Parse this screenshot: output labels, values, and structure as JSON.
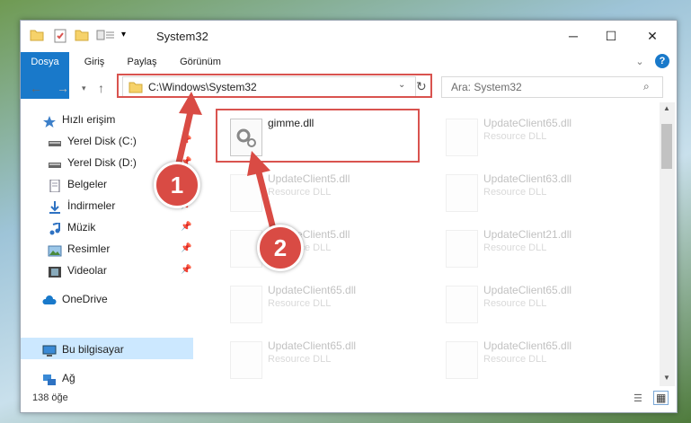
{
  "window": {
    "title": "System32",
    "controls": {
      "minimize": "─",
      "maximize": "☐",
      "close": "✕"
    }
  },
  "ribbon": {
    "tabs": [
      "Dosya",
      "Giriş",
      "Paylaş",
      "Görünüm"
    ],
    "expand": "⌄",
    "help": "?"
  },
  "address": {
    "path": "C:\\Windows\\System32",
    "search_placeholder": "Ara: System32"
  },
  "sidebar": {
    "items": [
      {
        "label": "Hızlı erişim",
        "icon": "star-icon"
      },
      {
        "label": "Yerel Disk (C:)",
        "icon": "drive-icon",
        "pinned": true
      },
      {
        "label": "Yerel Disk (D:)",
        "icon": "drive-icon",
        "pinned": true
      },
      {
        "label": "Belgeler",
        "icon": "documents-icon",
        "pinned": true
      },
      {
        "label": "İndirmeler",
        "icon": "download-icon",
        "pinned": true
      },
      {
        "label": "Müzik",
        "icon": "music-icon",
        "pinned": true
      },
      {
        "label": "Resimler",
        "icon": "pictures-icon",
        "pinned": true
      },
      {
        "label": "Videolar",
        "icon": "video-icon",
        "pinned": true
      },
      {
        "label": "OneDrive",
        "icon": "cloud-icon"
      },
      {
        "label": "Bu bilgisayar",
        "icon": "computer-icon",
        "selected": true
      },
      {
        "label": "Ağ",
        "icon": "network-icon"
      }
    ]
  },
  "files": [
    {
      "name": "gimme.dll",
      "desc": "",
      "highlighted": true
    },
    {
      "name": "UpdateClient65.dll",
      "desc": "Resource DLL"
    },
    {
      "name": "UpdateClient5.dll",
      "desc": "Resource DLL"
    },
    {
      "name": "UpdateClient63.dll",
      "desc": "Resource DLL"
    },
    {
      "name": "UpdateClient5.dll",
      "desc": "Resource DLL"
    },
    {
      "name": "UpdateClient21.dll",
      "desc": "Resource DLL"
    },
    {
      "name": "UpdateClient65.dll",
      "desc": "Resource DLL"
    },
    {
      "name": "UpdateClient65.dll",
      "desc": "Resource DLL"
    },
    {
      "name": "UpdateClient65.dll",
      "desc": "Resource DLL"
    },
    {
      "name": "UpdateClient65.dll",
      "desc": "Resource DLL"
    }
  ],
  "status": {
    "item_count": "138 öğe"
  },
  "annotations": {
    "step1": "1",
    "step2": "2",
    "color": "#d94b44"
  }
}
